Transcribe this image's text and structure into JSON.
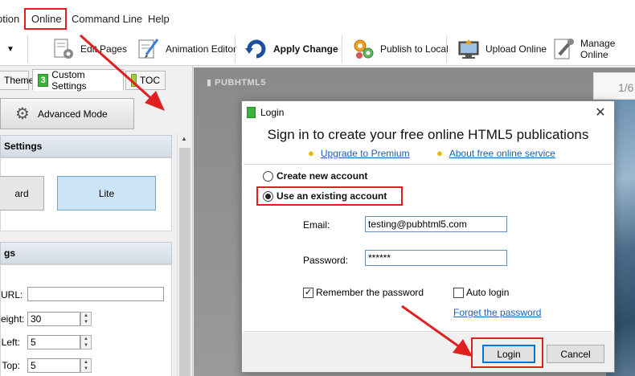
{
  "menu": {
    "items": [
      {
        "id": "option",
        "label": "ption"
      },
      {
        "id": "online",
        "label": "Online"
      },
      {
        "id": "command-line",
        "label": "Command Line"
      },
      {
        "id": "help",
        "label": "Help"
      }
    ]
  },
  "toolbar": {
    "edit_pages": "Edit Pages",
    "animation_editor": "Animation Editor",
    "apply_change": "Apply Change",
    "publish_to_local": "Publish to Local",
    "upload_online": "Upload Online",
    "manage_online": "Manage Online"
  },
  "left_panel": {
    "tabs": [
      {
        "label": "Theme",
        "num": ""
      },
      {
        "label": "Custom Settings",
        "num": "3"
      },
      {
        "label": "TOC",
        "num": ""
      }
    ],
    "advanced_mode": "Advanced Mode",
    "section1_title": "Settings",
    "mode_buttons": [
      "ard",
      "Lite"
    ],
    "section2_title": "gs",
    "fields": [
      {
        "label": "URL:",
        "value": ""
      },
      {
        "label": "eight:",
        "value": "30"
      },
      {
        "label": "Left:",
        "value": "5"
      },
      {
        "label": "Top:",
        "value": "5"
      }
    ]
  },
  "preview": {
    "logo": "PUBHTML5",
    "page_indicator": "1/6"
  },
  "dialog": {
    "title": "Login",
    "heading": "Sign in to create your free online HTML5 publications",
    "upgrade_link": "Upgrade to Premium",
    "about_link": "About free online service",
    "radio_create": "Create new account",
    "radio_existing": "Use an existing account",
    "email_label": "Email:",
    "email_value": "testing@pubhtml5.com",
    "password_label": "Password:",
    "password_value": "******",
    "remember_label": "Remember the password",
    "remember_checked": true,
    "autologin_label": "Auto login",
    "autologin_checked": false,
    "forget_link": "Forget the password",
    "login_button": "Login",
    "cancel_button": "Cancel"
  },
  "colors": {
    "annotation_red": "#e02020",
    "link_blue": "#1a5fb4",
    "tab_green": "#3db33d",
    "lite_selected": "#cce4f7"
  }
}
